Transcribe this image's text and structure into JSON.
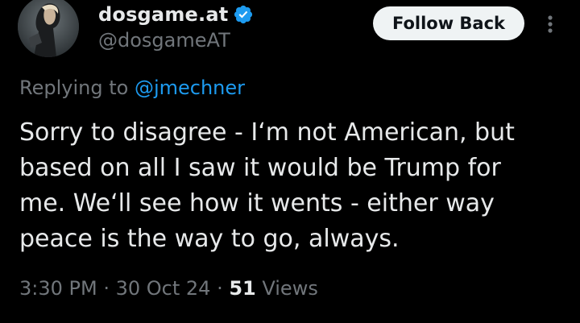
{
  "author": {
    "display_name": "dosgame.at",
    "handle": "@dosgameAT",
    "verified_icon": "verified-badge-icon",
    "avatar_alt": "profile-avatar"
  },
  "actions": {
    "follow_label": "Follow Back",
    "more_icon": "more-vertical-icon"
  },
  "reply": {
    "prefix": "Replying to ",
    "mention": "@jmechner"
  },
  "tweet": {
    "lines": [
      "Sorry to disagree - I‘m not American, but",
      "based on all I saw it would be Trump for",
      "me. We‘ll see how it wents - either way",
      "peace is the way to go, always."
    ]
  },
  "meta": {
    "time": "3:30 PM",
    "separator": " · ",
    "date": "30 Oct 24",
    "views_count": "51",
    "views_label": " Views"
  },
  "colors": {
    "background": "#000000",
    "text_primary": "#e7e9ea",
    "text_secondary": "#71767b",
    "accent": "#1d9bf0",
    "button_bg": "#eff3f4",
    "button_text": "#0f1419"
  }
}
